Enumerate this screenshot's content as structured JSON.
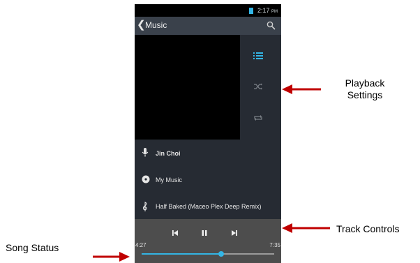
{
  "status_bar": {
    "time": "2:17",
    "ampm": "PM"
  },
  "action_bar": {
    "title": "Music",
    "back_glyph": "❮"
  },
  "now_playing": {
    "artist": "Jin Choi",
    "album": "My Music",
    "song": "Half Baked (Maceo Plex Deep Remix)",
    "time_elapsed": "4:27",
    "time_total": "7:35",
    "progress_fraction": 0.6,
    "state": "playing"
  },
  "side_icons": [
    "playlist-icon",
    "shuffle-icon",
    "repeat-icon"
  ],
  "controls": [
    "previous-track-icon",
    "pause-icon",
    "next-track-icon"
  ],
  "annotations": {
    "playback_settings_line1": "Playback",
    "playback_settings_line2": "Settings",
    "track_controls": "Track Controls",
    "song_status": "Song Status"
  },
  "colors": {
    "accent": "#33b5e5",
    "arrow": "#c00000",
    "screen_bg": "#262b33",
    "action_bar_bg": "#3a414b",
    "controls_bg": "#4d4d4d"
  }
}
